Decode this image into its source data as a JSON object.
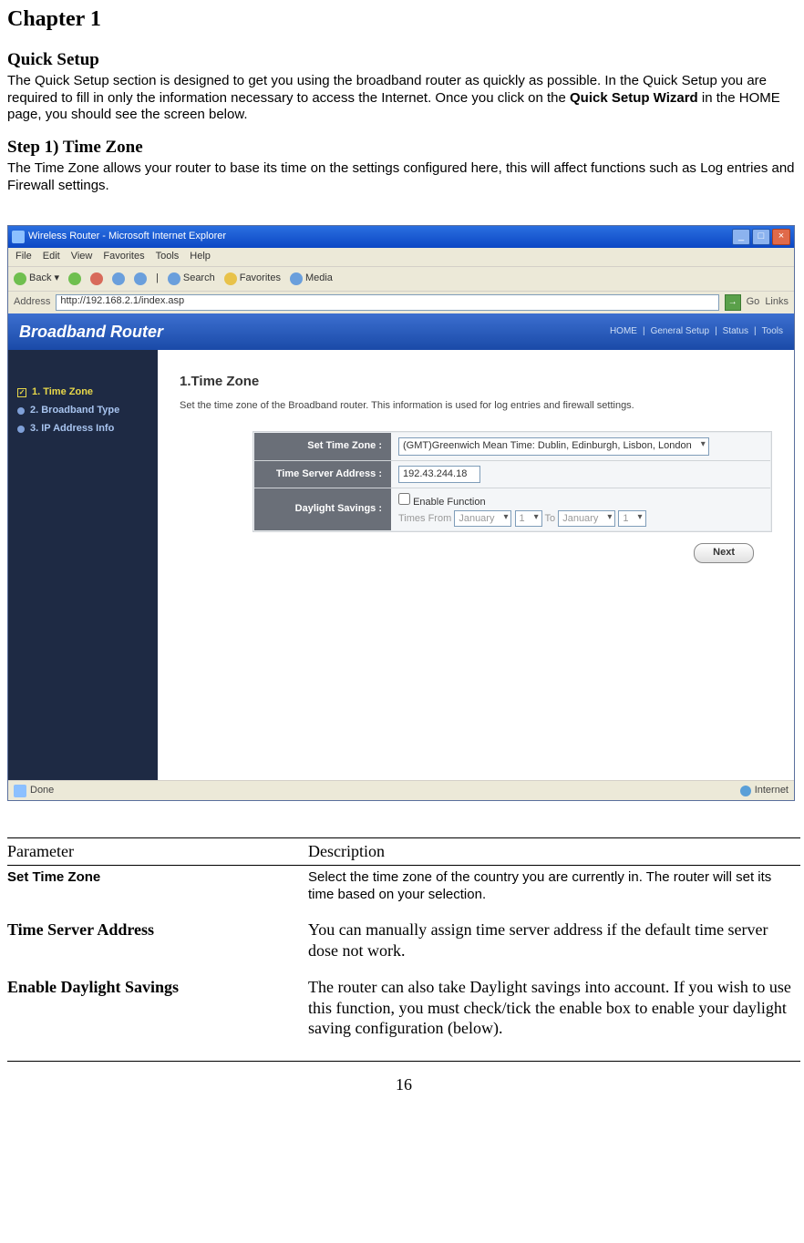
{
  "chapter_title": "Chapter 1",
  "quick_setup": {
    "heading": "Quick Setup",
    "para_prefix": "The Quick Setup section is designed to get you using the broadband router as quickly as possible. In the Quick Setup you are required to fill in only the information necessary to access the Internet. Once you click on the ",
    "para_bold": "Quick Setup Wizard",
    "para_suffix": " in the HOME page, you should see the screen below."
  },
  "step1": {
    "heading": "Step 1) Time Zone",
    "para": "The Time Zone allows your router to base its time on the settings configured here, this will affect functions such as Log entries and Firewall settings."
  },
  "ie": {
    "title": "Wireless Router - Microsoft Internet Explorer",
    "menus": [
      "File",
      "Edit",
      "View",
      "Favorites",
      "Tools",
      "Help"
    ],
    "toolbar": {
      "back": "Back",
      "search": "Search",
      "favorites": "Favorites",
      "media": "Media"
    },
    "address_label": "Address",
    "address_value": "http://192.168.2.1/index.asp",
    "go": "Go",
    "links": "Links",
    "status_done": "Done",
    "status_zone": "Internet"
  },
  "banner": {
    "title": "Broadband Router",
    "links": [
      "HOME",
      "General Setup",
      "Status",
      "Tools"
    ]
  },
  "sidenav": {
    "items": [
      {
        "label": "1. Time Zone",
        "active": true
      },
      {
        "label": "2. Broadband Type",
        "active": false
      },
      {
        "label": "3. IP Address Info",
        "active": false
      }
    ]
  },
  "main": {
    "heading": "1.Time Zone",
    "desc": "Set the time zone of the Broadband router. This information is used for log entries and firewall settings.",
    "rows": {
      "set_tz_label": "Set Time Zone :",
      "set_tz_value": "(GMT)Greenwich Mean Time: Dublin, Edinburgh, Lisbon, London",
      "ts_label": "Time Server Address :",
      "ts_value": "192.43.244.18",
      "ds_label": "Daylight Savings :",
      "ds_check": "Enable Function",
      "ds_from": "Times From",
      "ds_to": "To",
      "month": "January",
      "day": "1"
    },
    "next": "Next"
  },
  "param_table": {
    "h1": "Parameter",
    "h2": "Description",
    "rows": [
      {
        "param": "Set Time Zone",
        "desc": "Select the time zone of the country you are currently in. The router will set its time based on your selection.",
        "style": "arial"
      },
      {
        "param": "Time Server Address",
        "desc": "You can manually assign time server address if the default time server dose not work.",
        "style": "serif"
      },
      {
        "param": "Enable Daylight Savings",
        "desc": "The router can also take Daylight savings into account. If you wish to use this function, you must check/tick the enable box to enable your daylight saving configuration (below).",
        "style": "serif"
      }
    ]
  },
  "page_number": "16"
}
